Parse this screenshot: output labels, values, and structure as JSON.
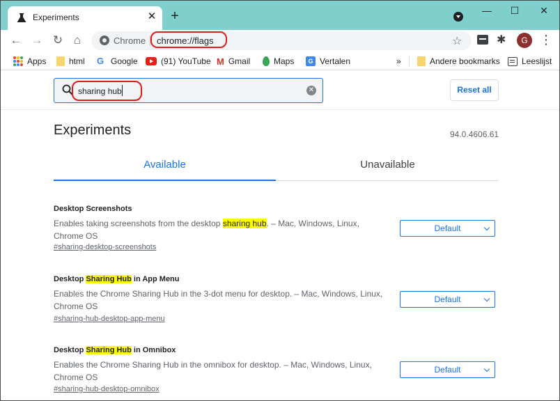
{
  "browser": {
    "tab_title": "Experiments",
    "tab_close": "✕",
    "new_tab": "+",
    "window_controls": {
      "minimize": "—",
      "maximize": "☐",
      "close": "✕"
    },
    "omnibox": {
      "site_label": "Chrome",
      "url": "chrome://flags"
    }
  },
  "bookmarks": [
    {
      "label": "Apps",
      "icon": "apps-grid-icon"
    },
    {
      "label": "html",
      "icon": "folder-icon"
    },
    {
      "label": "Google",
      "icon": "google-icon"
    },
    {
      "label": "(91) YouTube",
      "icon": "youtube-icon"
    },
    {
      "label": "Gmail",
      "icon": "gmail-icon"
    },
    {
      "label": "Maps",
      "icon": "maps-icon"
    },
    {
      "label": "Vertalen",
      "icon": "translate-icon"
    }
  ],
  "bookmarks_overflow": "»",
  "other_bookmarks": "Andere bookmarks",
  "reading_list": "Leeslijst",
  "avatar_letter": "G",
  "search": {
    "query": "sharing hub"
  },
  "reset_label": "Reset all",
  "page_title": "Experiments",
  "version": "94.0.4606.61",
  "tabs": {
    "available": "Available",
    "unavailable": "Unavailable"
  },
  "flags": [
    {
      "title_pre": "Desktop Screenshots",
      "title_hl": "",
      "title_post": "",
      "desc_pre": "Enables taking screenshots from the desktop ",
      "desc_hl": "sharing hub",
      "desc_post": ". – Mac, Windows, Linux, Chrome OS",
      "link": "#sharing-desktop-screenshots",
      "value": "Default"
    },
    {
      "title_pre": "Desktop ",
      "title_hl": "Sharing Hub",
      "title_post": " in App Menu",
      "desc_pre": "Enables the Chrome Sharing Hub in the 3-dot menu for desktop. – Mac, Windows, Linux, Chrome OS",
      "desc_hl": "",
      "desc_post": "",
      "link": "#sharing-hub-desktop-app-menu",
      "value": "Default"
    },
    {
      "title_pre": "Desktop ",
      "title_hl": "Sharing Hub",
      "title_post": " in Omnibox",
      "desc_pre": "Enables the Chrome Sharing Hub in the omnibox for desktop. – Mac, Windows, Linux, Chrome OS",
      "desc_hl": "",
      "desc_post": "",
      "link": "#sharing-hub-desktop-omnibox",
      "value": "Default"
    }
  ],
  "colors": {
    "titlebar": "#7fd0cc",
    "accent": "#1a73e8",
    "highlight": "#ffff00",
    "annotation": "#e01b1b"
  }
}
